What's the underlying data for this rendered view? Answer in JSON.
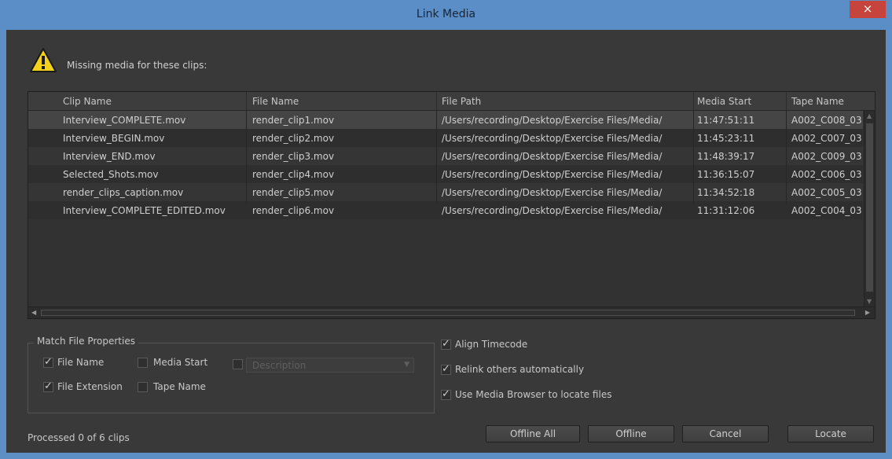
{
  "window": {
    "title": "Link Media",
    "close_glyph": "×"
  },
  "message": "Missing media for these clips:",
  "icons": {
    "warning": "warning-icon",
    "close": "close-icon"
  },
  "table": {
    "columns": [
      "Clip Name",
      "File Name",
      "File Path",
      "Media Start",
      "Tape Name"
    ],
    "rows": [
      [
        "Interview_COMPLETE.mov",
        "render_clip1.mov",
        "/Users/recording/Desktop/Exercise Files/Media/",
        "11:47:51:11",
        "A002_C008_03("
      ],
      [
        "Interview_BEGIN.mov",
        "render_clip2.mov",
        "/Users/recording/Desktop/Exercise Files/Media/",
        "11:45:23:11",
        "A002_C007_03("
      ],
      [
        "Interview_END.mov",
        "render_clip3.mov",
        "/Users/recording/Desktop/Exercise Files/Media/",
        "11:48:39:17",
        "A002_C009_03("
      ],
      [
        "Selected_Shots.mov",
        "render_clip4.mov",
        "/Users/recording/Desktop/Exercise Files/Media/",
        "11:36:15:07",
        "A002_C006_03("
      ],
      [
        "render_clips_caption.mov",
        "render_clip5.mov",
        "/Users/recording/Desktop/Exercise Files/Media/",
        "11:34:52:18",
        "A002_C005_03("
      ],
      [
        "Interview_COMPLETE_EDITED.mov",
        "render_clip6.mov",
        "/Users/recording/Desktop/Exercise Files/Media/",
        "11:31:12:06",
        "A002_C004_03("
      ]
    ]
  },
  "match_props": {
    "legend": "Match File Properties",
    "file_name": {
      "label": "File Name",
      "checked": true
    },
    "media_start": {
      "label": "Media Start",
      "checked": false
    },
    "file_extension": {
      "label": "File Extension",
      "checked": true
    },
    "tape_name": {
      "label": "Tape Name",
      "checked": false
    },
    "description": {
      "label": "Description",
      "checked": false,
      "enabled": false
    }
  },
  "options": {
    "align_timecode": {
      "label": "Align Timecode",
      "checked": true
    },
    "relink_others": {
      "label": "Relink others automatically",
      "checked": true
    },
    "use_media_browser": {
      "label": "Use Media Browser to locate files",
      "checked": true
    }
  },
  "status": "Processed 0 of 6 clips",
  "buttons": {
    "offline_all": "Offline All",
    "offline": "Offline",
    "cancel": "Cancel",
    "locate": "Locate"
  },
  "colors": {
    "title_bar": "#5b8ec6",
    "close_button": "#c7443d",
    "panel": "#393939",
    "warning_yellow": "#f3d21c"
  }
}
